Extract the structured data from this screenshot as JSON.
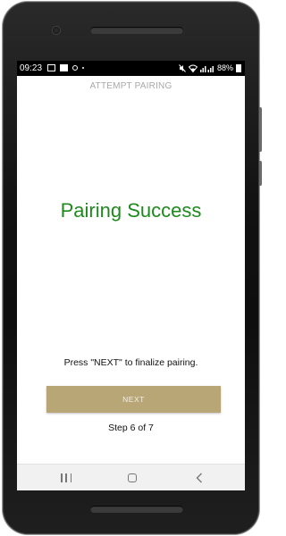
{
  "status_bar": {
    "time": "09:23",
    "battery": "88%"
  },
  "header": {
    "title": "ATTEMPT PAIRING"
  },
  "main": {
    "heading": "Pairing Success",
    "instruction": "Press \"NEXT\" to finalize pairing.",
    "next_label": "NEXT",
    "step_text": "Step 6 of 7"
  },
  "nav_bar": {
    "recent_icon": "recent-apps-icon",
    "home_icon": "home-icon",
    "back_icon": "back-icon"
  },
  "colors": {
    "success_green": "#1e8a1e",
    "button_gold": "#b9a676",
    "header_gray": "#a8a8a8"
  }
}
